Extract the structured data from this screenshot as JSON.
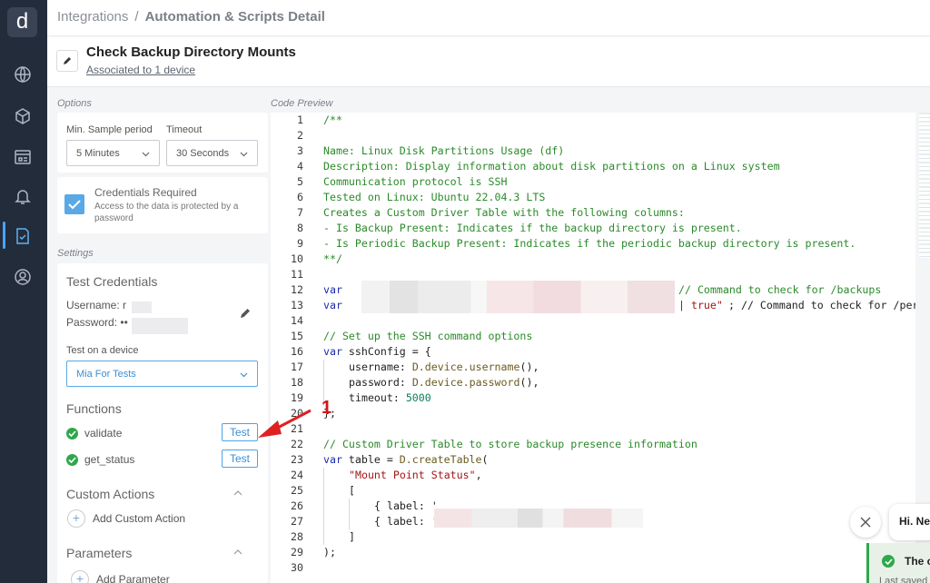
{
  "breadcrumb": {
    "root": "Integrations",
    "separator": "/",
    "current": "Automation & Scripts Detail"
  },
  "header": {
    "title": "Check Backup Directory Mounts",
    "associated": "Associated to 1 device"
  },
  "options": {
    "section_label": "Options",
    "min_sample_label": "Min. Sample period",
    "min_sample_value": "5 Minutes",
    "timeout_label": "Timeout",
    "timeout_value": "30 Seconds",
    "credentials_title": "Credentials Required",
    "credentials_desc": "Access to the data is protected by a password"
  },
  "settings": {
    "section_label": "Settings",
    "test_credentials_title": "Test Credentials",
    "username_label": "Username:",
    "username_value": "r",
    "password_label": "Password:",
    "password_value": "••",
    "test_device_label": "Test on a device",
    "test_device_value": "Mia For Tests"
  },
  "functions": {
    "title": "Functions",
    "items": [
      {
        "name": "validate",
        "button": "Test"
      },
      {
        "name": "get_status",
        "button": "Test"
      }
    ]
  },
  "custom_actions": {
    "title": "Custom Actions",
    "add_label": "Add Custom Action"
  },
  "parameters": {
    "title": "Parameters",
    "add_label": "Add Parameter"
  },
  "code_preview": {
    "label": "Code Preview",
    "line_numbers": [
      "1",
      "2",
      "3",
      "4",
      "5",
      "6",
      "7",
      "8",
      "9",
      "10",
      "11",
      "12",
      "13",
      "14",
      "15",
      "16",
      "17",
      "18",
      "19",
      "20",
      "21",
      "22",
      "23",
      "24",
      "25",
      "26",
      "27",
      "28",
      "29",
      "30"
    ],
    "l1": "/**",
    "l3": "Name: Linux Disk Partitions Usage (df)",
    "l4": "Description: Display information about disk partitions on a Linux system",
    "l5": "Communication protocol is SSH",
    "l6": "Tested on Linux: Ubuntu 22.04.3 LTS",
    "l7": "Creates a Custom Driver Table with the following columns:",
    "l8": "- Is Backup Present: Indicates if the backup directory is present.",
    "l9": "- Is Periodic Backup Present: Indicates if the periodic backup directory is present.",
    "l10": "**/",
    "kw_var": "var",
    "l12_comment": "// Command to check for /backups",
    "l13_str": "| true\"",
    "l13_rest": "; // Command to check for /peri",
    "l15": "// Set up the SSH command options",
    "l16_name": " sshConfig = {",
    "l17_a": "username: ",
    "l17_b": "D.device.username",
    "l17_c": "(),",
    "l18_a": "password: ",
    "l18_b": "D.device.password",
    "l18_c": "(),",
    "l19_a": "timeout: ",
    "l19_b": "5000",
    "l20": "};",
    "l22": "// Custom Driver Table to store backup presence information",
    "l23_name": " table = ",
    "l23_fn": "D.createTable",
    "l23_paren": "(",
    "l24": "\"Mount Point Status\"",
    "l24_comma": ",",
    "l25": "[",
    "l26": "{ label: '",
    "l27": "{ label: '",
    "l28": "]",
    "l29": ");"
  },
  "annotation": {
    "number": "1"
  },
  "chat": {
    "greeting": "Hi. Ne"
  },
  "toast": {
    "title": "The c",
    "subtitle": "Last saved"
  },
  "colors": {
    "nav_bg": "#232c3b",
    "accent": "#4aa3e6",
    "success": "#2ea84b",
    "arrow": "#e02020"
  }
}
